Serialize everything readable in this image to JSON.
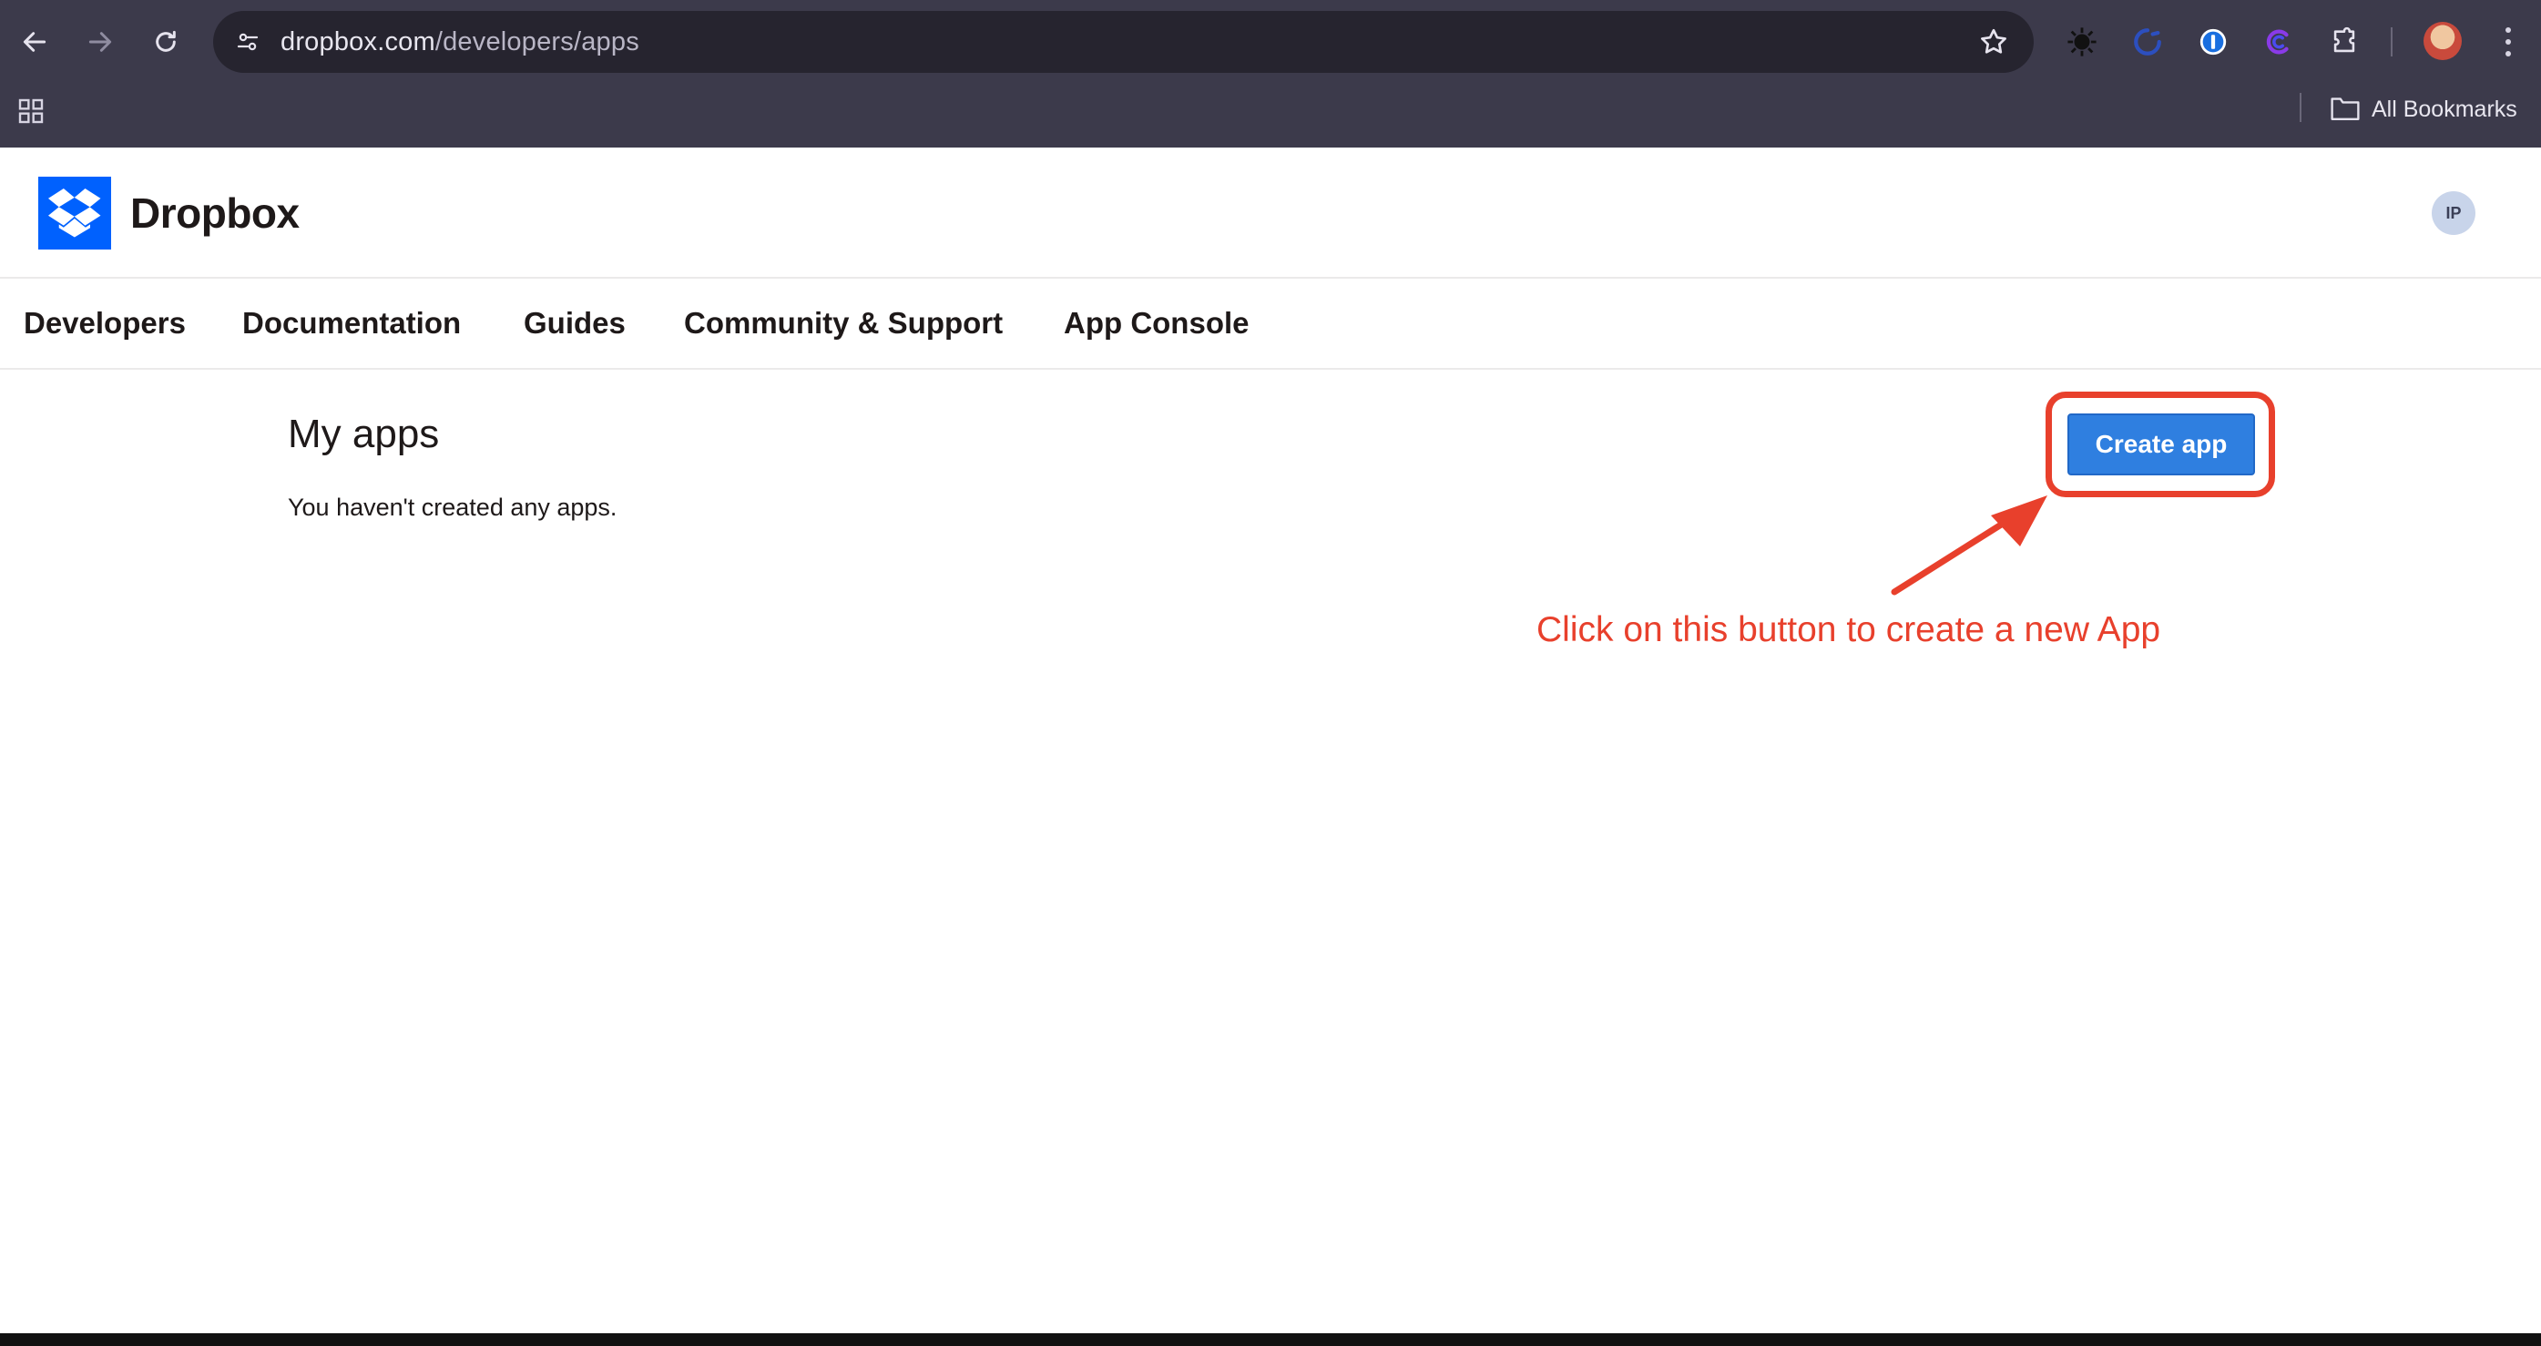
{
  "browser": {
    "url_host": "dropbox.com",
    "url_path": "/developers/apps",
    "bookmarks_label": "All Bookmarks"
  },
  "site": {
    "brand": "Dropbox",
    "user_initials": "IP",
    "nav": [
      {
        "label": "Developers"
      },
      {
        "label": "Documentation"
      },
      {
        "label": "Guides"
      },
      {
        "label": "Community & Support"
      },
      {
        "label": "App Console"
      }
    ]
  },
  "main": {
    "title": "My apps",
    "empty_message": "You haven't created any apps.",
    "create_button_label": "Create app"
  },
  "annotation": {
    "text": "Click on this button to create a new App",
    "color": "#e8402c"
  },
  "colors": {
    "brand_blue": "#0061fe",
    "button_blue": "#2f7fe0",
    "chrome_bg": "#3c3a4b"
  }
}
